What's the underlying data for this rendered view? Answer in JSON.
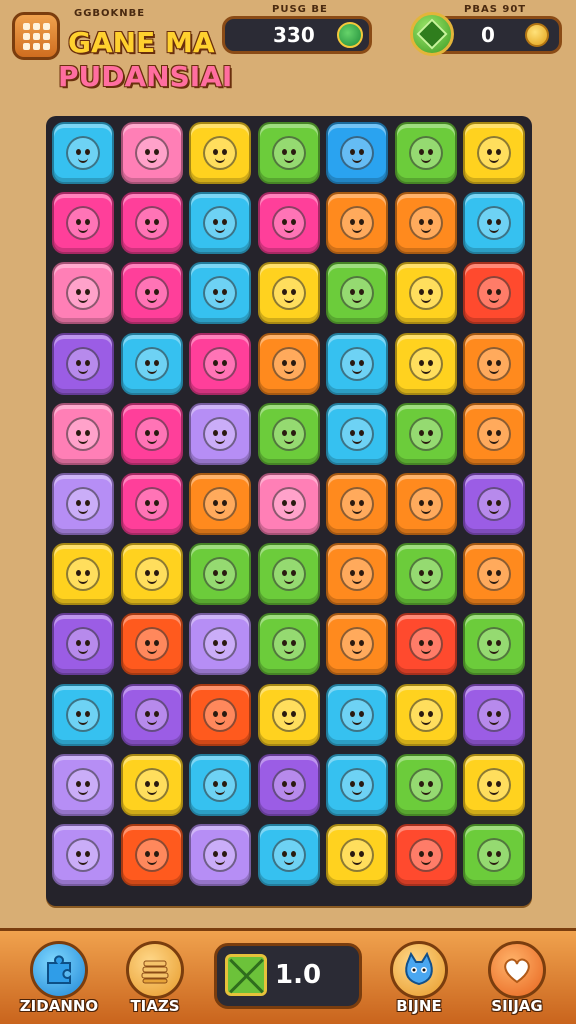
{
  "header": {
    "menu_icon": "grid-menu-icon",
    "title_small": "GGBOKNBE",
    "title_line1": "GANE MA",
    "title_line2": "PUDANSIAI",
    "score_label": "PUSG BE",
    "score_value": "330",
    "score_icon": "globe-badge-icon",
    "coins_label": "PBAS 90T",
    "coins_value": "0",
    "gem_icon": "green-gem-icon",
    "coin_icon": "gold-coin-icon"
  },
  "board": {
    "rows": 11,
    "cols": 7,
    "tiles": [
      [
        "#36c1f0",
        "#ff7fb6",
        "#ffd21f",
        "#6ccc3b",
        "#2aa3f0",
        "#6ccc3b",
        "#ffd21f"
      ],
      [
        "#ff3f9a",
        "#ff3f9a",
        "#36c1f0",
        "#ff3f9a",
        "#ff8a1e",
        "#ff8a1e",
        "#36c1f0"
      ],
      [
        "#ff7fb6",
        "#ff3f9a",
        "#36c1f0",
        "#ffd21f",
        "#6ccc3b",
        "#ffd21f",
        "#ff4a2e"
      ],
      [
        "#9b5de5",
        "#36c1f0",
        "#ff3f9a",
        "#ff8a1e",
        "#36c1f0",
        "#ffd21f",
        "#ff8a1e"
      ],
      [
        "#ff7fb6",
        "#ff3f9a",
        "#b68ef5",
        "#6ccc3b",
        "#36c1f0",
        "#6ccc3b",
        "#ff8a1e"
      ],
      [
        "#b68ef5",
        "#ff3f9a",
        "#ff8a1e",
        "#ff7fb6",
        "#ff8a1e",
        "#ff8a1e",
        "#9b5de5"
      ],
      [
        "#ffd21f",
        "#ffd21f",
        "#6ccc3b",
        "#6ccc3b",
        "#ff8a1e",
        "#6ccc3b",
        "#ff8a1e"
      ],
      [
        "#9b5de5",
        "#ff5a1e",
        "#b68ef5",
        "#6ccc3b",
        "#ff8a1e",
        "#ff4a2e",
        "#6ccc3b"
      ],
      [
        "#36c1f0",
        "#9b5de5",
        "#ff5a1e",
        "#ffd21f",
        "#36c1f0",
        "#ffd21f",
        "#9b5de5"
      ],
      [
        "#b68ef5",
        "#ffd21f",
        "#36c1f0",
        "#9b5de5",
        "#36c1f0",
        "#6ccc3b",
        "#ffd21f"
      ],
      [
        "#b68ef5",
        "#ff5a1e",
        "#b68ef5",
        "#36c1f0",
        "#ffd21f",
        "#ff4a2e",
        "#6ccc3b"
      ]
    ]
  },
  "footer": {
    "btn1_label": "ZIDANNO",
    "btn1_icon": "blue-puzzle-icon",
    "btn2_label": "TIAZS",
    "btn2_icon": "pancake-stack-icon",
    "center_icon": "green-crossed-box-icon",
    "center_value": "1.0",
    "btn3_label": "BIJNE",
    "btn3_icon": "blue-cat-icon",
    "btn4_label": "SIIJAG",
    "btn4_icon": "heart-icon"
  }
}
